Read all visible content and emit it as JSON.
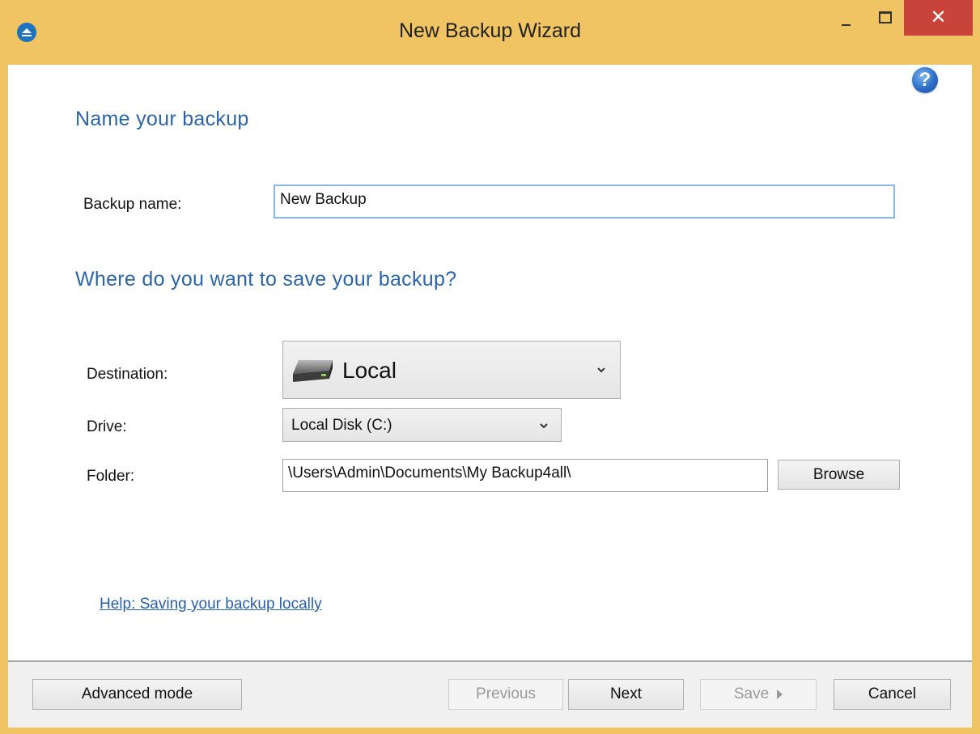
{
  "window": {
    "title": "New Backup Wizard",
    "close_glyph": "✕"
  },
  "help_icon_glyph": "?",
  "name_section": {
    "heading": "Name your backup",
    "backup_name_label": "Backup name:",
    "backup_name_value": "New Backup"
  },
  "save_section": {
    "heading": "Where do you want to save your backup?",
    "destination_label": "Destination:",
    "destination_value": "Local",
    "destination_icon": "hard-drive-icon",
    "drive_label": "Drive:",
    "drive_value": "Local Disk (C:)",
    "folder_label": "Folder:",
    "folder_value": "\\Users\\Admin\\Documents\\My Backup4all\\",
    "browse_label": "Browse"
  },
  "help_link": "Help: Saving your backup locally",
  "footer": {
    "advanced_label": "Advanced mode",
    "previous_label": "Previous",
    "next_label": "Next",
    "save_label": "Save",
    "cancel_label": "Cancel"
  },
  "colors": {
    "title_bar": "#f0c463",
    "close_button": "#c8443a",
    "heading": "#2c64a8",
    "link": "#2a5fa5"
  }
}
